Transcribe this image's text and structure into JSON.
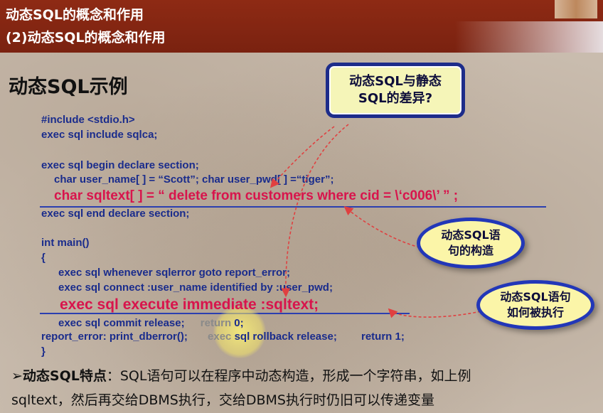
{
  "header": {
    "title": "动态SQL的概念和作用",
    "subtitle": "(2)动态SQL的概念和作用"
  },
  "page_title": "动态SQL示例",
  "code": {
    "l1": "#include <stdio.h>",
    "l2": "exec  sql  include  sqlca;",
    "l3": "exec sql begin declare section;",
    "l4": "char  user_name[ ] = “Scott”;  char  user_pwd[ ] =“tiger”;",
    "l5": "char  sqltext[ ] = “ delete  from  customers  where  cid = \\‘c006\\’ ” ;",
    "l6": "exec sql end declare section;",
    "l7": "int main()",
    "l8": "{",
    "l9": "exec sql whenever  sqlerror  goto report_error;",
    "l10": "exec sql connect  :user_name  identified by  :user_pwd;",
    "l11": "exec  sql   execute  immediate  :sqltext;",
    "l12a": "exec sql commit  release;",
    "l12b": "return",
    "l12c": "0;",
    "l13a": "report_error:   print_dberror();",
    "l13b": "exec",
    "l13c": "sql  rollback  release;",
    "l13d": "return 1;",
    "l14": "}"
  },
  "callouts": {
    "difference": "动态SQL与静态SQL的差异?",
    "difference_line1": "动态SQL与静态",
    "difference_line2": "SQL的差异?",
    "construct_line1": "动态SQL语",
    "construct_line2": "句的构造",
    "execute_line1": "动态SQL语句",
    "execute_line2": "如何被执行"
  },
  "bottom": {
    "line1_bullet": "➢",
    "line1_label": "动态SQL特点",
    "line1_rest": "：SQL语句可以在程序中动态构造，形成一个字符串，如上例",
    "line2": "sqltext，然后再交给DBMS执行，交给DBMS执行时仍旧可以传递变量"
  },
  "colors": {
    "header_bg": "#8e2a14",
    "code_blue": "#1a2c8c",
    "code_red": "#d8144c",
    "callout_border": "#1d2c8a",
    "callout_fill": "#f5f5b8",
    "arrow": "#e04040"
  }
}
